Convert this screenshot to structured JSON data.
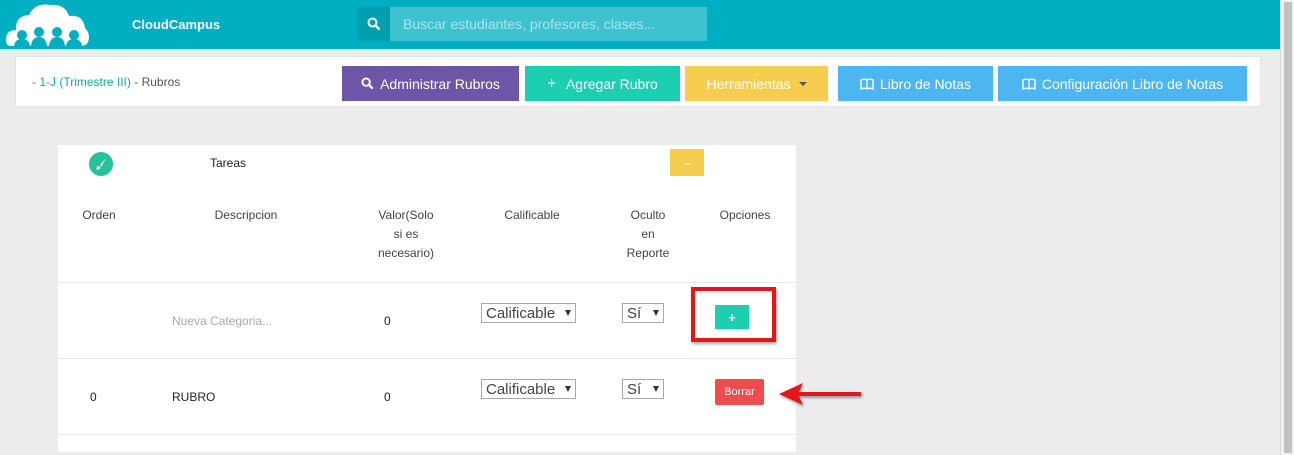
{
  "app": {
    "brand": "CloudCampus",
    "search_placeholder": "Buscar estudiantes, profesores, clases..."
  },
  "breadcrumb": {
    "link": "- 1-J (Trimestre III)",
    "current": "- Rubros"
  },
  "toolbar": {
    "manage_label": "Administrar Rubros",
    "add_label": "Agregar Rubro",
    "tools_label": "Herramientas",
    "gradebook_label": "Libro de Notas",
    "gradebook_config_label": "Configuración Libro de Notas"
  },
  "category": {
    "title": "Tareas",
    "collapse_label": "–"
  },
  "table": {
    "headers": {
      "order": "Orden",
      "description": "Descripcion",
      "value_line1": "Valor(Solo",
      "value_line2": "si es",
      "value_line3": "necesario)",
      "gradable": "Calificable",
      "hidden_line1": "Oculto",
      "hidden_line2": "en",
      "hidden_line3": "Reporte",
      "options": "Opciones"
    },
    "new_row": {
      "description_placeholder": "Nueva Categoria...",
      "value": "0",
      "gradable": "Calificable",
      "hidden": "Sí",
      "add_label": "+"
    },
    "rows": [
      {
        "order": "0",
        "description": "RUBRO",
        "value": "0",
        "gradable": "Calificable",
        "hidden": "Sí",
        "delete_label": "Borrar"
      }
    ]
  },
  "colors": {
    "topbar": "#00aec2",
    "annotation": "#e3161b"
  }
}
